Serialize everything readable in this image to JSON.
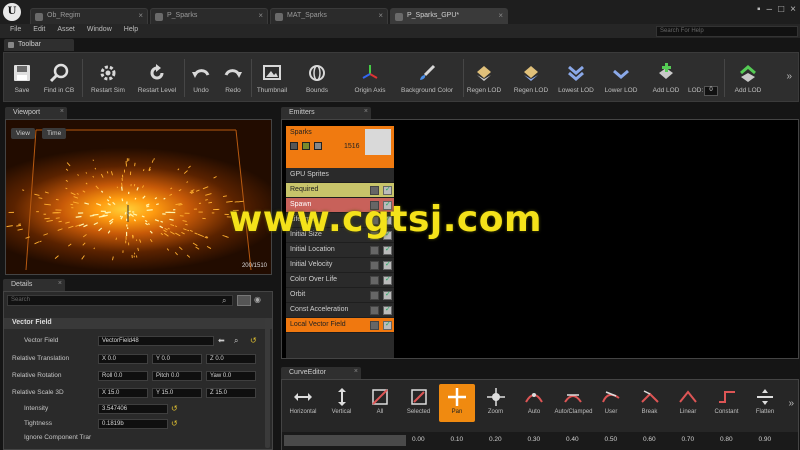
{
  "window": {
    "tabs": [
      {
        "label": "Ob_Regim",
        "active": false
      },
      {
        "label": "P_Sparks",
        "active": false
      },
      {
        "label": "MAT_Sparks",
        "active": false
      },
      {
        "label": "P_Sparks_GPU*",
        "active": true
      }
    ],
    "search_help_placeholder": "Search For Help"
  },
  "menu": [
    "File",
    "Edit",
    "Asset",
    "Window",
    "Help"
  ],
  "toolbar": {
    "tab_label": "Toolbar",
    "buttons": [
      {
        "label": "Save",
        "icon": "save-icon"
      },
      {
        "label": "Find in CB",
        "icon": "find-icon"
      },
      {
        "label": "Restart Sim",
        "icon": "restart-sim-icon"
      },
      {
        "label": "Restart Level",
        "icon": "restart-level-icon"
      },
      {
        "label": "Undo",
        "icon": "undo-icon"
      },
      {
        "label": "Redo",
        "icon": "redo-icon"
      },
      {
        "label": "Thumbnail",
        "icon": "thumbnail-icon"
      },
      {
        "label": "Bounds",
        "icon": "bounds-icon"
      },
      {
        "label": "Origin Axis",
        "icon": "origin-axis-icon"
      },
      {
        "label": "Background Color",
        "icon": "background-color-icon"
      },
      {
        "label": "Regen LOD",
        "icon": "regen-lod-icon"
      },
      {
        "label": "Regen LOD",
        "icon": "regen-lod-icon"
      },
      {
        "label": "Lowest LOD",
        "icon": "lowest-lod-icon"
      },
      {
        "label": "Lower LOD",
        "icon": "lower-lod-icon"
      },
      {
        "label": "Add LOD",
        "icon": "add-lod-icon"
      },
      {
        "label": "Add LOD",
        "icon": "add-lod-icon"
      }
    ],
    "lod_label": "LOD:",
    "lod_value": "0"
  },
  "viewport": {
    "tab_label": "Viewport",
    "view_label": "View",
    "time_label": "Time",
    "stat_text": "200/1510"
  },
  "emitters": {
    "tab_label": "Emitters",
    "emitter_name": "Sparks",
    "particle_count": "1516",
    "modules": [
      {
        "label": "GPU Sprites",
        "style": "plain"
      },
      {
        "label": "Required",
        "style": "required"
      },
      {
        "label": "Spawn",
        "style": "spawn"
      },
      {
        "label": "Lifetime",
        "style": "plain"
      },
      {
        "label": "Initial Size",
        "style": "plain"
      },
      {
        "label": "Initial Location",
        "style": "plain"
      },
      {
        "label": "Initial Velocity",
        "style": "plain"
      },
      {
        "label": "Color Over Life",
        "style": "plain"
      },
      {
        "label": "Orbit",
        "style": "plain"
      },
      {
        "label": "Const Acceleration",
        "style": "plain"
      },
      {
        "label": "Local Vector Field",
        "style": "selected"
      }
    ]
  },
  "details": {
    "tab_label": "Details",
    "search_placeholder": "Search",
    "category": "Vector Field",
    "vector_field_label": "Vector Field",
    "vector_field_value": "VectorField48",
    "relative_translation_label": "Relative Translation",
    "relative_rotation_label": "Relative Rotation",
    "relative_scale_label": "Relative Scale 3D",
    "intensity_label": "Intensity",
    "intensity_value": "3.547406",
    "tightness_label": "Tightness",
    "tightness_value": "0.1819b",
    "ignore_label": "Ignore Component Trar",
    "translation": {
      "x": "X 0.0",
      "y": "Y 0.0",
      "z": "Z 0.0"
    },
    "rotation": {
      "x": "Roll 0.0",
      "y": "Pitch 0.0",
      "z": "Yaw 0.0"
    },
    "scale": {
      "x": "X 15.0",
      "y": "Y 15.0",
      "z": "Z 15.0"
    }
  },
  "curve_editor": {
    "tab_label": "CurveEditor",
    "buttons": [
      {
        "label": "Horizontal",
        "icon": "horizontal-icon"
      },
      {
        "label": "Vertical",
        "icon": "vertical-icon"
      },
      {
        "label": "All",
        "icon": "all-icon"
      },
      {
        "label": "Selected",
        "icon": "selected-icon"
      },
      {
        "label": "Pan",
        "icon": "pan-icon"
      },
      {
        "label": "Zoom",
        "icon": "zoom-icon"
      },
      {
        "label": "Auto",
        "icon": "auto-icon"
      },
      {
        "label": "Auto/Clamped",
        "icon": "auto-clamped-icon"
      },
      {
        "label": "User",
        "icon": "user-icon"
      },
      {
        "label": "Break",
        "icon": "break-icon"
      },
      {
        "label": "Linear",
        "icon": "linear-icon"
      },
      {
        "label": "Constant",
        "icon": "constant-icon"
      },
      {
        "label": "Flatten",
        "icon": "flatten-icon"
      }
    ],
    "active_button": "Pan",
    "timeline_ticks": [
      "0.00",
      "0.10",
      "0.20",
      "0.30",
      "0.40",
      "0.50",
      "0.60",
      "0.70",
      "0.80",
      "0.90"
    ]
  },
  "watermark": "www.cgtsj.com",
  "colors": {
    "accent_orange": "#f07a10",
    "required_module": "#c8c46a",
    "spawn_module": "#c8615a",
    "selected_module": "#f0780f",
    "watermark_yellow": "#f4e21a"
  }
}
